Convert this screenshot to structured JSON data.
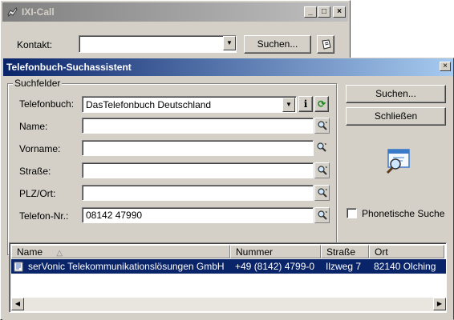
{
  "bg_window": {
    "title": "IXI-Call",
    "contact_label": "Kontakt:",
    "search_button": "Suchen...",
    "titlebar_buttons": [
      "_",
      "□",
      "×"
    ]
  },
  "dialog": {
    "title": "Telefonbuch-Suchassistent",
    "close_glyph": "×",
    "group_label": "Suchfelder",
    "fields": {
      "telefonbuch": {
        "label": "Telefonbuch:",
        "value": "DasTelefonbuch Deutschland"
      },
      "name": {
        "label": "Name:",
        "value": ""
      },
      "vorname": {
        "label": "Vorname:",
        "value": ""
      },
      "strasse": {
        "label": "Straße:",
        "value": ""
      },
      "plz_ort": {
        "label": "PLZ/Ort:",
        "value": ""
      },
      "telefon_nr": {
        "label": "Telefon-Nr.:",
        "value": "08142 47990"
      }
    },
    "info_glyph": "i",
    "refresh_glyph": "⟳",
    "dropdown_glyph": "▼",
    "search_button": "Suchen...",
    "close_button": "Schließen",
    "phonetic_label": "Phonetische Suche",
    "phonetic_checked": false,
    "results": {
      "columns": [
        "Name",
        "Nummer",
        "Straße",
        "Ort"
      ],
      "sort_glyph": "△",
      "rows": [
        {
          "name": "serVonic Telekommunikationslösungen GmbH",
          "number": "+49 (8142) 4799-0",
          "street": "Ilzweg 7",
          "city": "82140 Olching"
        }
      ]
    },
    "scroll_left": "◀",
    "scroll_right": "▶"
  },
  "colors": {
    "titlebar_active": "#0a246a",
    "titlebar_inactive": "#808080",
    "window_face": "#d4d0c8",
    "selection": "#0a246a"
  }
}
